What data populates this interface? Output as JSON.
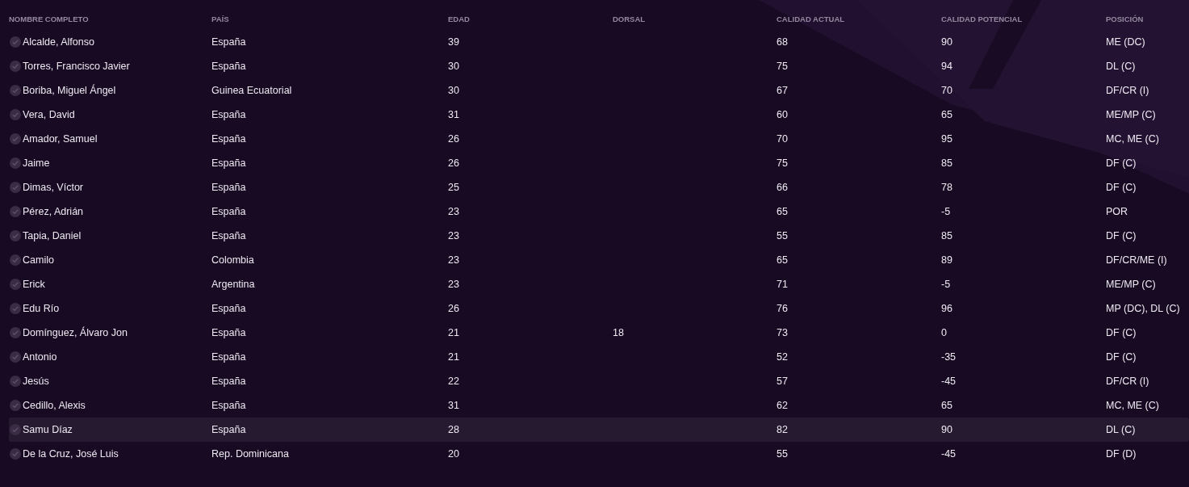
{
  "table": {
    "columns": [
      "NOMBRE COMPLETO",
      "PAÍS",
      "EDAD",
      "DORSAL",
      "CALIDAD ACTUAL",
      "CALIDAD POTENCIAL",
      "POSICIÓN"
    ],
    "rows": [
      {
        "name": "Alcalde, Alfonso",
        "country": "España",
        "age": "39",
        "current_ability": "68",
        "potential_ability": "90",
        "position": "ME (DC)",
        "selected": false
      },
      {
        "name": "Torres, Francisco Javier",
        "country": "España",
        "age": "30",
        "current_ability": "75",
        "potential_ability": "94",
        "position": "DL (C)",
        "selected": false
      },
      {
        "name": "Boriba, Miguel Ángel",
        "country": "Guinea Ecuatorial",
        "age": "30",
        "current_ability": "67",
        "potential_ability": "70",
        "position": "DF/CR (I)",
        "selected": false
      },
      {
        "name": "Vera, David",
        "country": "España",
        "age": "31",
        "current_ability": "60",
        "potential_ability": "65",
        "position": "ME/MP (C)",
        "selected": false
      },
      {
        "name": "Amador, Samuel",
        "country": "España",
        "age": "26",
        "current_ability": "70",
        "potential_ability": "95",
        "position": "MC, ME (C)",
        "selected": false
      },
      {
        "name": "Jaime",
        "country": "España",
        "age": "26",
        "current_ability": "75",
        "potential_ability": "85",
        "position": "DF (C)",
        "selected": false
      },
      {
        "name": "Dimas, Víctor",
        "country": "España",
        "age": "25",
        "current_ability": "66",
        "potential_ability": "78",
        "position": "DF (C)",
        "selected": false
      },
      {
        "name": "Pérez, Adrián",
        "country": "España",
        "age": "23",
        "current_ability": "65",
        "potential_ability": "-5",
        "position": "POR",
        "selected": false
      },
      {
        "name": "Tapia, Daniel",
        "country": "España",
        "age": "23",
        "current_ability": "55",
        "potential_ability": "85",
        "position": "DF (C)",
        "selected": false
      },
      {
        "name": "Camilo",
        "country": "Colombia",
        "age": "23",
        "current_ability": "65",
        "potential_ability": "89",
        "position": "DF/CR/ME (I)",
        "selected": false
      },
      {
        "name": "Erick",
        "country": "Argentina",
        "age": "23",
        "current_ability": "71",
        "potential_ability": "-5",
        "position": "ME/MP (C)",
        "selected": false
      },
      {
        "name": "Edu Río",
        "country": "España",
        "age": "26",
        "current_ability": "76",
        "potential_ability": "96",
        "position": "MP (DC), DL (C)",
        "selected": false
      },
      {
        "name": "Domínguez, Álvaro Jon",
        "country": "España",
        "age": "21",
        "number": "18",
        "current_ability": "73",
        "potential_ability": "0",
        "position": "DF (C)",
        "selected": false
      },
      {
        "name": "Antonio",
        "country": "España",
        "age": "21",
        "current_ability": "52",
        "potential_ability": "-35",
        "position": "DF (C)",
        "selected": false
      },
      {
        "name": "Jesús",
        "country": "España",
        "age": "22",
        "current_ability": "57",
        "potential_ability": "-45",
        "position": "DF/CR (I)",
        "selected": false
      },
      {
        "name": "Cedillo, Alexis",
        "country": "España",
        "age": "31",
        "current_ability": "62",
        "potential_ability": "65",
        "position": "MC, ME (C)",
        "selected": false
      },
      {
        "name": "Samu Díaz",
        "country": "España",
        "age": "28",
        "current_ability": "82",
        "potential_ability": "90",
        "position": "DL (C)",
        "selected": true
      },
      {
        "name": "De la Cruz, José Luis",
        "country": "Rep. Dominicana",
        "age": "20",
        "current_ability": "55",
        "potential_ability": "-45",
        "position": "DF (D)",
        "selected": false
      }
    ]
  }
}
